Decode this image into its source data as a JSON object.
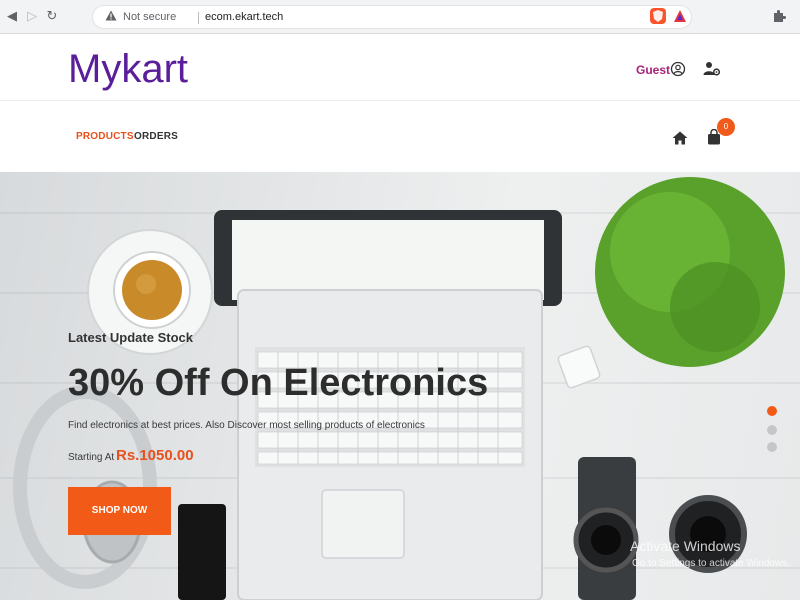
{
  "browser": {
    "security_label": "Not secure",
    "url": "ecom.ekart.tech",
    "brave_shield_count": "2"
  },
  "header": {
    "brand": "Mykart",
    "guest_label": "Guest"
  },
  "nav": {
    "products_label": "PRODUCTS",
    "orders_label": "ORDERS",
    "cart_count": "0"
  },
  "hero": {
    "subtitle": "Latest Update Stock",
    "title": "30% Off On Electronics",
    "description": "Find electronics at best prices. Also Discover most selling products of electronics",
    "starting_label": "Starting At",
    "price": "Rs.1050.00",
    "button_label": "SHOP NOW",
    "active_slide": 1,
    "slide_count": 3
  },
  "watermark": {
    "title": "Activate Windows",
    "subtitle": "Go to Settings to activate Windows."
  },
  "colors": {
    "brand": "#5b1e9a",
    "accent": "#f25a17",
    "guest": "#a8227a"
  }
}
